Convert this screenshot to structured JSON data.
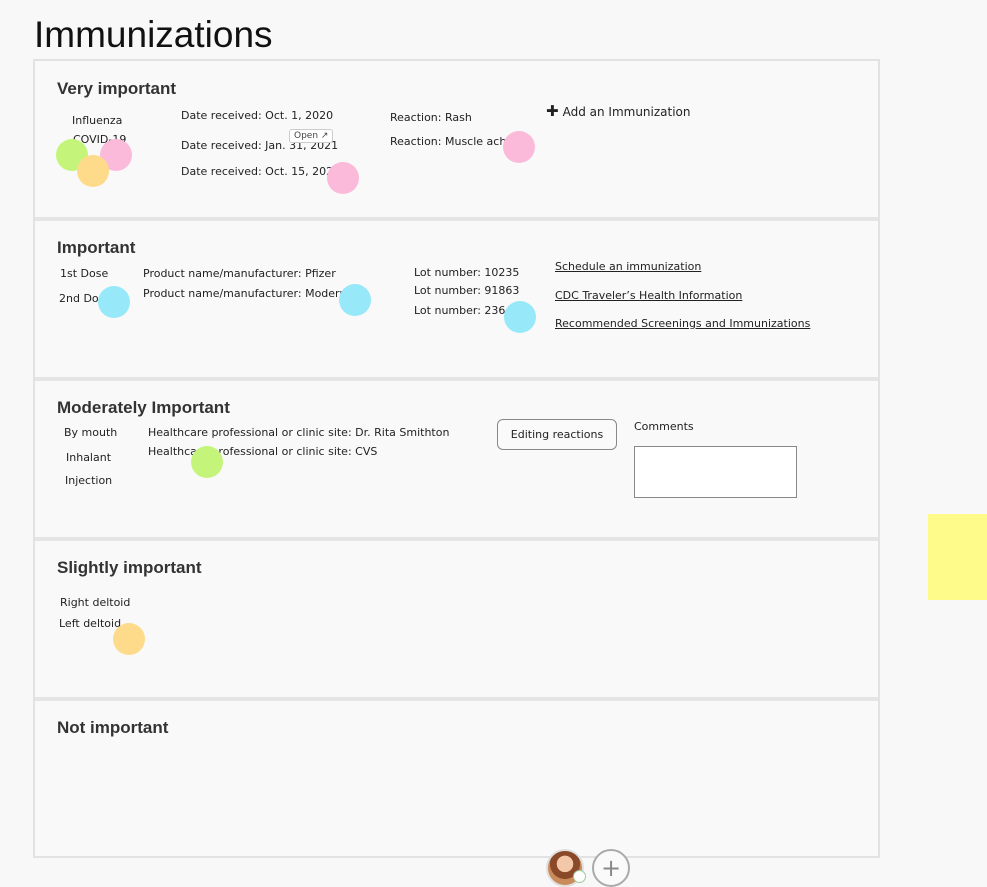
{
  "page": {
    "title": "Immunizations"
  },
  "sections": {
    "very_important": {
      "title": "Very important",
      "names": [
        "Influenza",
        "COVID-19"
      ],
      "dates": [
        "Date received: Oct. 1, 2020",
        "Date received: Jan. 31, 2021",
        "Date received: Oct. 15, 2020"
      ],
      "reactions": [
        "Reaction: Rash",
        "Reaction: Muscle ache"
      ],
      "open_chip": "Open",
      "add_label": "Add an Immunization"
    },
    "important": {
      "title": "Important",
      "doses": [
        "1st Dose",
        "2nd Dose"
      ],
      "products": [
        "Product name/manufacturer: Pfizer",
        "Product name/manufacturer: Moderna"
      ],
      "lots": [
        "Lot number: 10235",
        "Lot number: 91863",
        "Lot number: 23645"
      ],
      "links": [
        "Schedule an immunization",
        "CDC Traveler’s Health Information",
        "Recommended Screenings and Immunizations"
      ]
    },
    "moderately_important": {
      "title": "Moderately Important",
      "routes": [
        "By mouth",
        "Inhalant",
        "Injection"
      ],
      "sites": [
        "Healthcare professional or clinic site: Dr. Rita Smithton",
        "Healthcare professional or clinic site: CVS"
      ],
      "editing_button": "Editing reactions",
      "comments_label": "Comments"
    },
    "slightly_important": {
      "title": "Slightly important",
      "locations": [
        "Right deltoid",
        "Left deltoid"
      ]
    },
    "not_important": {
      "title": "Not important"
    }
  },
  "dot_colors": {
    "pink": "#fbbad9",
    "green": "#c4f57a",
    "orange": "#fddb8b",
    "cyan": "#97e9f9",
    "sticky": "#fffb8a"
  },
  "toolbar": {
    "add_icon": "plus-circle-icon",
    "avatar": "user-avatar"
  }
}
